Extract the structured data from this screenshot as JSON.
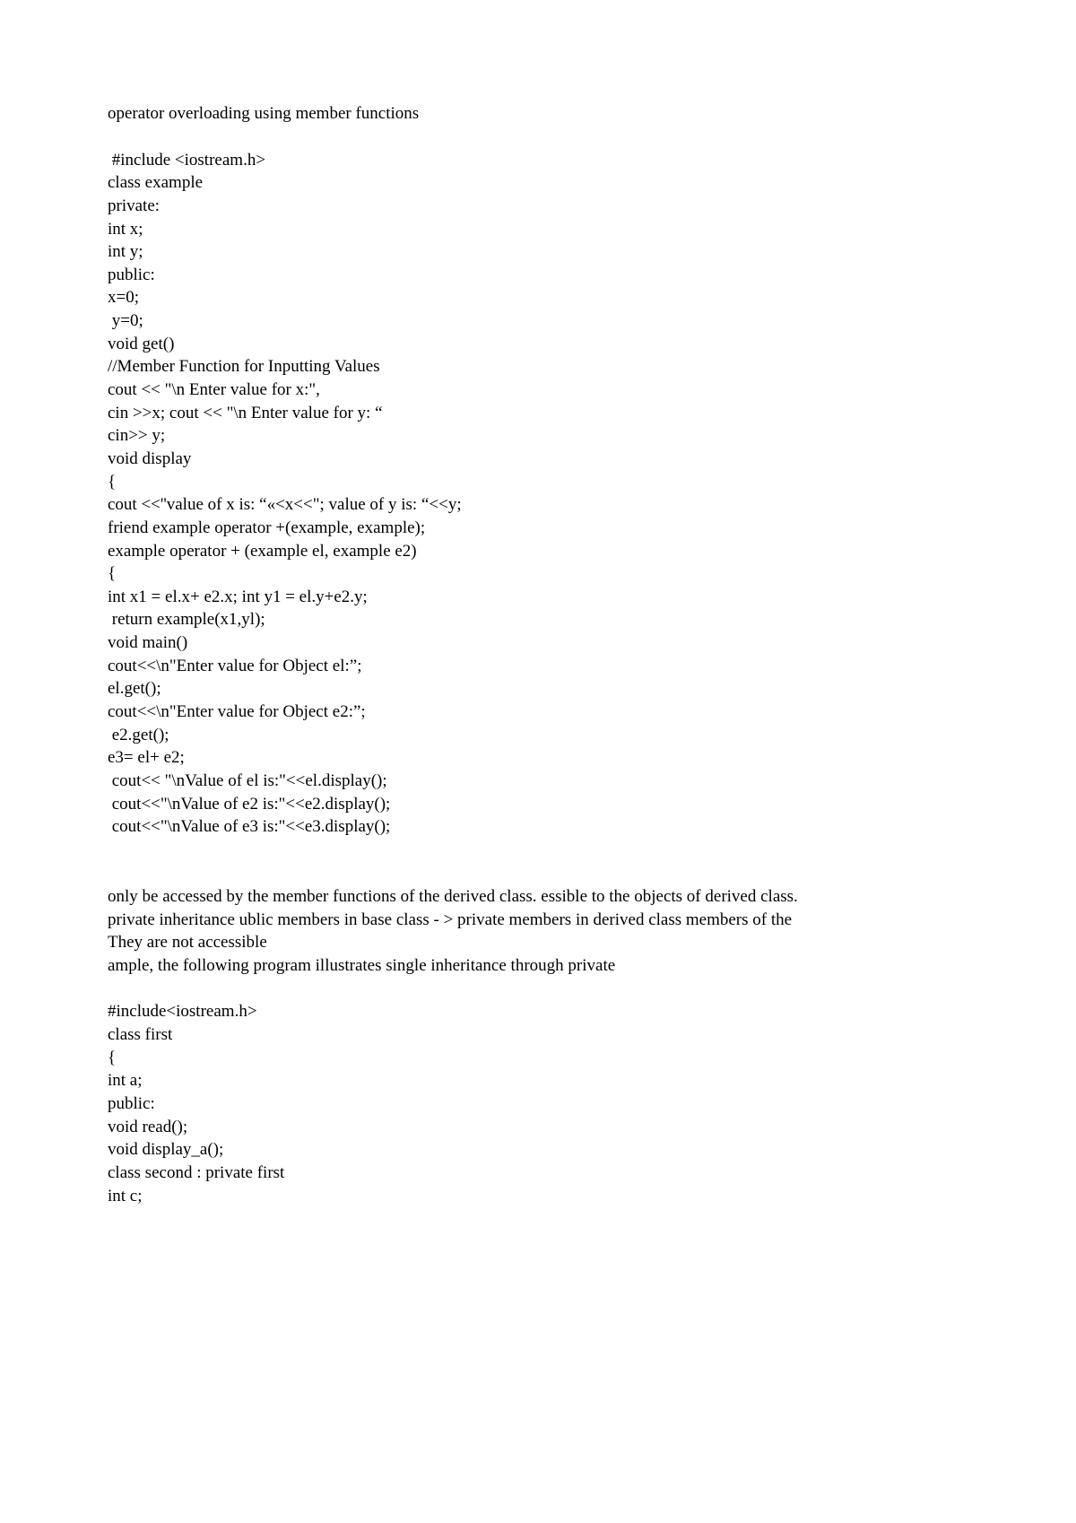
{
  "title": "operator overloading using member functions",
  "code1": [
    " #include <iostream.h>",
    "class example",
    "private:",
    "int x;",
    "int y;",
    "public:",
    "x=0;",
    " y=0;",
    "void get()",
    "//Member Function for Inputting Values",
    "cout << \"\\n Enter value for x:\",",
    "cin >>x; cout << \"\\n Enter value for y: “",
    "cin>> y;",
    "void display",
    "{",
    "cout <<''value of x is: “«<x<<\"; value of y is: “<<y;",
    "friend example operator +(example, example);",
    "example operator + (example el, example e2)",
    "{",
    "int x1 = el.x+ e2.x; int y1 = el.y+e2.y;",
    " return example(x1,yl);",
    "void main()",
    "cout<<\\n\"Enter value for Object el:”;",
    "el.get();",
    "cout<<\\n\"Enter value for Object e2:”;",
    " e2.get();",
    "e3= el+ e2;",
    " cout<< \"\\nValue of el is:\"<<el.display();",
    " cout<<\"\\nValue of e2 is:\"<<e2.display();",
    " cout<<\"\\nValue of e3 is:\"<<e3.display();"
  ],
  "para": [
    "only be accessed by the member functions of the derived class. essible to the objects of derived class.",
    "private inheritance ublic members in base class - > private members in derived class members of the",
    "They are not accessible",
    "ample, the following program illustrates single inheritance through private"
  ],
  "code2": [
    "#include<iostream.h>",
    "class first",
    "{",
    "int a;",
    "public:",
    "void read();",
    "void display_a();",
    "class second : private first",
    "int c;"
  ]
}
